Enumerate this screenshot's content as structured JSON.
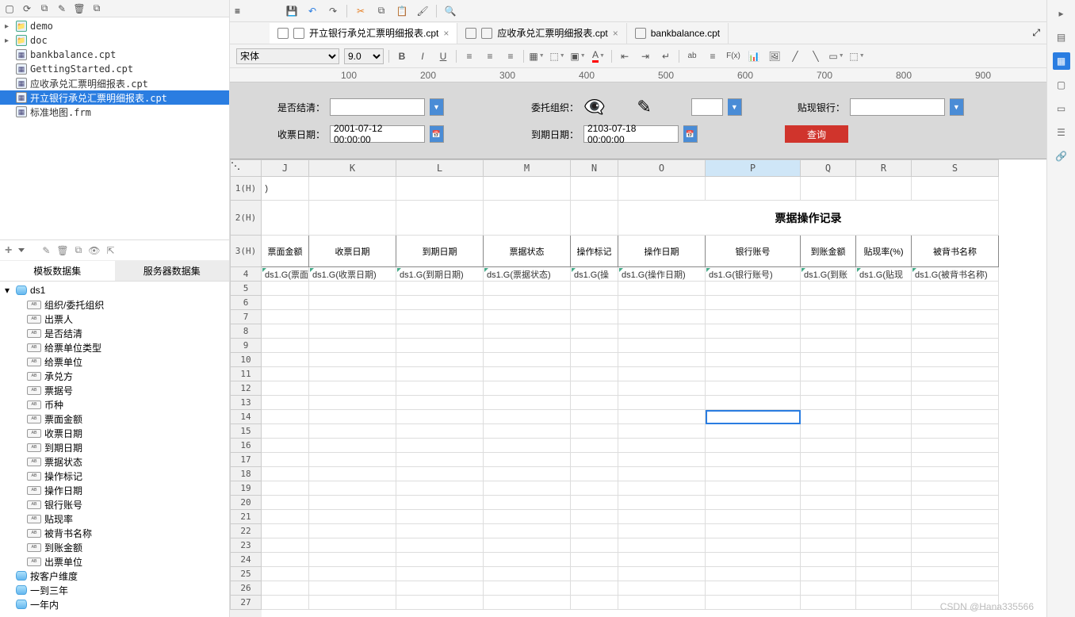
{
  "files": {
    "folders": [
      "demo",
      "doc"
    ],
    "items": [
      "bankbalance.cpt",
      "GettingStarted.cpt",
      "应收承兑汇票明细报表.cpt",
      "开立银行承兑汇票明细报表.cpt",
      "标准地图.frm"
    ],
    "selected": "开立银行承兑汇票明细报表.cpt"
  },
  "dataset": {
    "tabs": {
      "template": "模板数据集",
      "server": "服务器数据集"
    },
    "root": "ds1",
    "fields": [
      "组织/委托组织",
      "出票人",
      "是否结清",
      "给票单位类型",
      "给票单位",
      "承兑方",
      "票据号",
      "币种",
      "票面金额",
      "收票日期",
      "到期日期",
      "票据状态",
      "操作标记",
      "操作日期",
      "银行账号",
      "贴现率",
      "被背书名称",
      "到账金额",
      "出票单位"
    ],
    "dims": [
      "按客户维度",
      "一到三年",
      "一年内"
    ]
  },
  "editor": {
    "tabs": [
      {
        "label": "开立银行承兑汇票明细报表.cpt",
        "active": true,
        "closable": true,
        "icons": 2
      },
      {
        "label": "应收承兑汇票明细报表.cpt",
        "active": false,
        "closable": true,
        "icons": 2
      },
      {
        "label": "bankbalance.cpt",
        "active": false,
        "closable": false,
        "icons": 1
      }
    ],
    "font": {
      "name": "宋体",
      "size": "9.0"
    }
  },
  "ruler": [
    "100",
    "200",
    "300",
    "400",
    "500",
    "600",
    "700",
    "800",
    "900"
  ],
  "params": {
    "labels": {
      "settle": "是否结清：",
      "org": "委托组织：",
      "bank": "贴现银行：",
      "recv": "收票日期：",
      "due": "到期日期："
    },
    "values": {
      "recv": "2001-07-12 00:00:00",
      "due": "2103-07-18 00:00:00"
    },
    "query": "查询"
  },
  "grid": {
    "cols": [
      {
        "k": "J",
        "w": 60
      },
      {
        "k": "K",
        "w": 110
      },
      {
        "k": "L",
        "w": 110
      },
      {
        "k": "M",
        "w": 110
      },
      {
        "k": "N",
        "w": 60
      },
      {
        "k": "O",
        "w": 110
      },
      {
        "k": "P",
        "w": 120
      },
      {
        "k": "Q",
        "w": 70
      },
      {
        "k": "R",
        "w": 70
      },
      {
        "k": "S",
        "w": 110
      }
    ],
    "rows": [
      {
        "k": "1(H)",
        "h": 30
      },
      {
        "k": "2(H)",
        "h": 44
      },
      {
        "k": "3(H)",
        "h": 40
      },
      {
        "k": "4",
        "h": 18
      },
      {
        "k": "5",
        "h": 18
      },
      {
        "k": "6",
        "h": 18
      },
      {
        "k": "7",
        "h": 18
      },
      {
        "k": "8",
        "h": 18
      },
      {
        "k": "9",
        "h": 18
      },
      {
        "k": "10",
        "h": 18
      },
      {
        "k": "11",
        "h": 18
      },
      {
        "k": "12",
        "h": 18
      },
      {
        "k": "13",
        "h": 18
      },
      {
        "k": "14",
        "h": 18
      },
      {
        "k": "15",
        "h": 18
      },
      {
        "k": "16",
        "h": 18
      },
      {
        "k": "17",
        "h": 18
      },
      {
        "k": "18",
        "h": 18
      },
      {
        "k": "19",
        "h": 18
      },
      {
        "k": "20",
        "h": 18
      },
      {
        "k": "21",
        "h": 18
      },
      {
        "k": "22",
        "h": 18
      },
      {
        "k": "23",
        "h": 18
      },
      {
        "k": "24",
        "h": 18
      },
      {
        "k": "25",
        "h": 18
      },
      {
        "k": "26",
        "h": 18
      },
      {
        "k": "27",
        "h": 18
      }
    ],
    "title_row1": "）",
    "title_row2": "票据操作记录",
    "headers": [
      "票面金额",
      "收票日期",
      "到期日期",
      "票据状态",
      "操作标记",
      "操作日期",
      "银行账号",
      "到账金额",
      "贴现率(%)",
      "被背书名称"
    ],
    "formulas": [
      "ds1.G(票面",
      "ds1.G(收票日期)",
      "ds1.G(到期日期)",
      "ds1.G(票据状态)",
      "ds1.G(操",
      "ds1.G(操作日期)",
      "ds1.G(银行账号)",
      "ds1.G(到账",
      "ds1.G(贴现",
      "ds1.G(被背书名称)"
    ],
    "selected": {
      "row": 14,
      "col": "P"
    }
  },
  "watermark": "CSDN @Hana335566"
}
